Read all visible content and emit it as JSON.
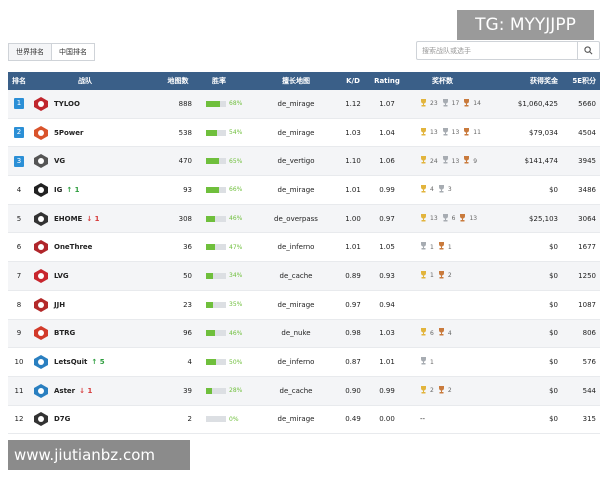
{
  "watermarks": {
    "telegram": "TG: MYYJJPP",
    "url": "www.jiutianbz.com"
  },
  "tabs": [
    {
      "label": "世界排名",
      "active": true
    },
    {
      "label": "中国排名",
      "active": false
    }
  ],
  "search": {
    "placeholder": "搜索战队或选手",
    "icon": "search-icon"
  },
  "columns": {
    "rank": "排名",
    "team": "战队",
    "maps": "地图数",
    "winrate": "胜率",
    "best_map": "擅长地图",
    "kd": "K/D",
    "rating": "Rating",
    "trophies": "奖杯数",
    "prize": "获得奖金",
    "points": "5E积分"
  },
  "colors": {
    "header": "#3a5f88",
    "rank_badge": "#2b8fd6",
    "win_bar": "#6fbf3c",
    "up": "#2e9d3e",
    "down": "#d63a3a"
  },
  "rows": [
    {
      "rank": "1",
      "top3": true,
      "team": "TYLOO",
      "delta": "",
      "dir": "",
      "maps": "888",
      "winrate": "68%",
      "win": 0.68,
      "map": "de_mirage",
      "kd": "1.12",
      "rating": "1.07",
      "gold": "23",
      "silver": "17",
      "bronze": "14",
      "prize": "$1,060,425",
      "points": "5660",
      "logo_color": "#c0262d"
    },
    {
      "rank": "2",
      "top3": true,
      "team": "5Power",
      "delta": "",
      "dir": "",
      "maps": "538",
      "winrate": "54%",
      "win": 0.54,
      "map": "de_mirage",
      "kd": "1.03",
      "rating": "1.04",
      "gold": "13",
      "silver": "13",
      "bronze": "11",
      "prize": "$79,034",
      "points": "4504",
      "logo_color": "#d9532b"
    },
    {
      "rank": "3",
      "top3": true,
      "team": "VG",
      "delta": "",
      "dir": "",
      "maps": "470",
      "winrate": "65%",
      "win": 0.65,
      "map": "de_vertigo",
      "kd": "1.10",
      "rating": "1.06",
      "gold": "24",
      "silver": "13",
      "bronze": "9",
      "prize": "$141,474",
      "points": "3945",
      "logo_color": "#555555"
    },
    {
      "rank": "4",
      "top3": false,
      "team": "IG",
      "delta": "1",
      "dir": "up",
      "maps": "93",
      "winrate": "66%",
      "win": 0.66,
      "map": "de_mirage",
      "kd": "1.01",
      "rating": "0.99",
      "gold": "4",
      "silver": "3",
      "bronze": "",
      "prize": "$0",
      "points": "3486",
      "logo_color": "#222222"
    },
    {
      "rank": "5",
      "top3": false,
      "team": "EHOME",
      "delta": "1",
      "dir": "down",
      "maps": "308",
      "winrate": "46%",
      "win": 0.46,
      "map": "de_overpass",
      "kd": "1.00",
      "rating": "0.97",
      "gold": "13",
      "silver": "6",
      "bronze": "13",
      "prize": "$25,103",
      "points": "3064",
      "logo_color": "#333333"
    },
    {
      "rank": "6",
      "top3": false,
      "team": "OneThree",
      "delta": "",
      "dir": "",
      "maps": "36",
      "winrate": "47%",
      "win": 0.47,
      "map": "de_inferno",
      "kd": "1.01",
      "rating": "1.05",
      "gold": "",
      "silver": "1",
      "bronze": "1",
      "prize": "$0",
      "points": "1677",
      "logo_color": "#b0262b"
    },
    {
      "rank": "7",
      "top3": false,
      "team": "LVG",
      "delta": "",
      "dir": "",
      "maps": "50",
      "winrate": "34%",
      "win": 0.34,
      "map": "de_cache",
      "kd": "0.89",
      "rating": "0.93",
      "gold": "1",
      "silver": "",
      "bronze": "2",
      "prize": "$0",
      "points": "1250",
      "logo_color": "#c8262e"
    },
    {
      "rank": "8",
      "top3": false,
      "team": "JJH",
      "delta": "",
      "dir": "",
      "maps": "23",
      "winrate": "35%",
      "win": 0.35,
      "map": "de_mirage",
      "kd": "0.97",
      "rating": "0.94",
      "gold": "",
      "silver": "",
      "bronze": "",
      "prize": "$0",
      "points": "1087",
      "logo_color": "#b42a2a"
    },
    {
      "rank": "9",
      "top3": false,
      "team": "BTRG",
      "delta": "",
      "dir": "",
      "maps": "96",
      "winrate": "46%",
      "win": 0.46,
      "map": "de_nuke",
      "kd": "0.98",
      "rating": "1.03",
      "gold": "6",
      "silver": "",
      "bronze": "4",
      "prize": "$0",
      "points": "806",
      "logo_color": "#d23a2a"
    },
    {
      "rank": "10",
      "top3": false,
      "team": "LetsQuit",
      "delta": "5",
      "dir": "up",
      "maps": "4",
      "winrate": "50%",
      "win": 0.5,
      "map": "de_inferno",
      "kd": "0.87",
      "rating": "1.01",
      "gold": "",
      "silver": "1",
      "bronze": "",
      "prize": "$0",
      "points": "576",
      "logo_color": "#2a7fc0"
    },
    {
      "rank": "11",
      "top3": false,
      "team": "Aster",
      "delta": "1",
      "dir": "down",
      "maps": "39",
      "winrate": "28%",
      "win": 0.28,
      "map": "de_cache",
      "kd": "0.90",
      "rating": "0.99",
      "gold": "2",
      "silver": "",
      "bronze": "2",
      "prize": "$0",
      "points": "544",
      "logo_color": "#2a7fc0"
    },
    {
      "rank": "12",
      "top3": false,
      "team": "D7G",
      "delta": "",
      "dir": "",
      "maps": "2",
      "winrate": "0%",
      "win": 0.0,
      "map": "de_mirage",
      "kd": "0.49",
      "rating": "0.00",
      "gold": "",
      "silver": "",
      "bronze": "",
      "no_trophy": "--",
      "prize": "$0",
      "points": "315",
      "logo_color": "#333333"
    }
  ]
}
